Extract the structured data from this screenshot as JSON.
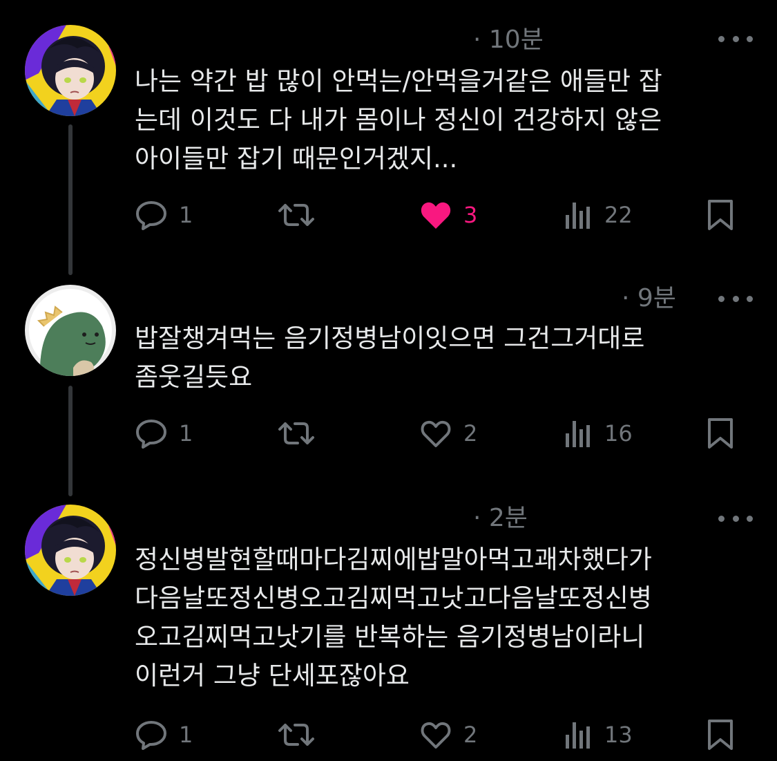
{
  "colors": {
    "background": "#000000",
    "text": "#e7e9ea",
    "muted": "#71767b",
    "like_active": "#f91880",
    "thread_line": "#333639"
  },
  "tweets": [
    {
      "time": "· 10분",
      "text": "나는 약간 밥 많이 안먹는/안먹을거같은 애들만 잡\n는데 이것도 다 내가 몸이나 정신이 건강하지 않은\n아이들만 잡기 때문인거겠지...",
      "avatar": "anime-character-avatar",
      "replies": "1",
      "retweets": "",
      "likes": "3",
      "liked": true,
      "views": "22"
    },
    {
      "time": "· 9분",
      "text": "밥잘챙겨먹는 음기정병남이잇으면 그건그거대로\n좀웃길듯요",
      "avatar": "green-dinosaur-avatar",
      "replies": "1",
      "retweets": "",
      "likes": "2",
      "liked": false,
      "views": "16"
    },
    {
      "time": "· 2분",
      "text": "정신병발현할때마다김찌에밥말아먹고괘차했다가\n다음날또정신병오고김찌먹고낫고다음날또정신병\n오고김찌먹고낫기를 반복하는 음기정병남이라니\n이런거 그냥 단세포잖아요",
      "avatar": "anime-character-avatar",
      "replies": "1",
      "retweets": "",
      "likes": "2",
      "liked": false,
      "views": "13"
    }
  ],
  "icons": {
    "reply": "reply-bubble-icon",
    "retweet": "retweet-icon",
    "like": "heart-icon",
    "views": "views-chart-icon",
    "bookmark": "bookmark-icon",
    "more": "more-dots-icon"
  }
}
